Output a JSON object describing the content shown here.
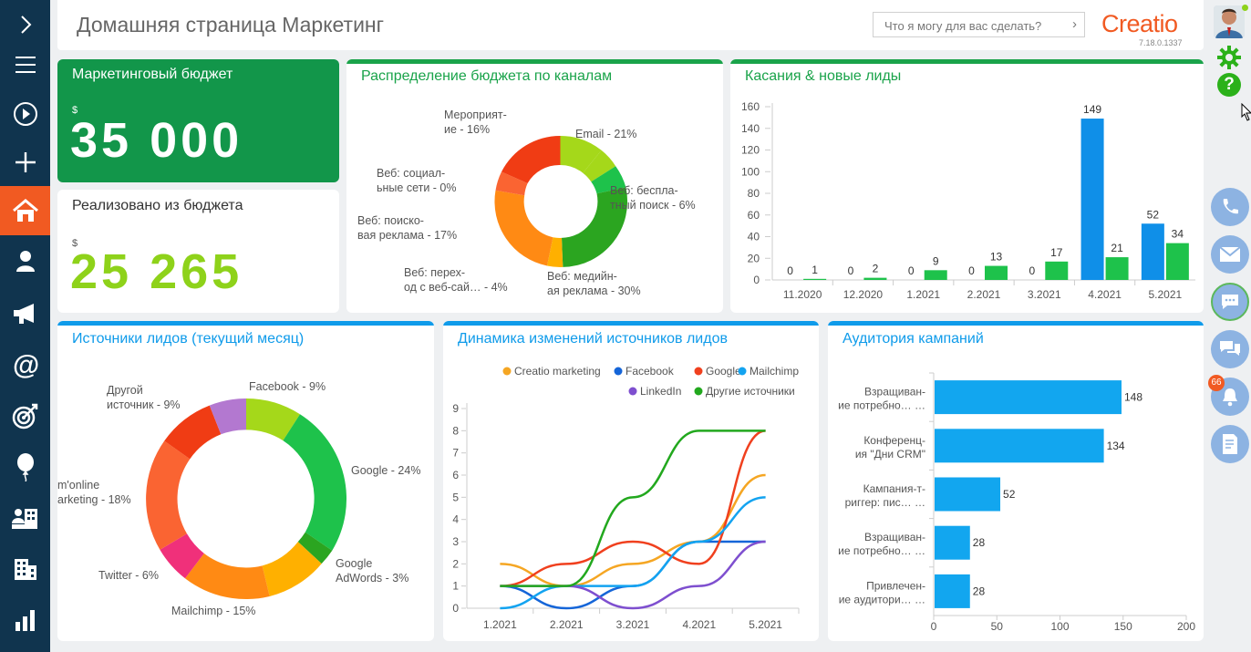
{
  "header": {
    "title": "Домашняя страница Маркетинг",
    "search_placeholder": "Что я могу для вас сделать?",
    "logo": "Creatio",
    "version": "7.18.0.1337"
  },
  "left_nav": {
    "items": [
      "expand-icon",
      "menu-icon",
      "play-icon",
      "add-icon",
      "home-icon",
      "contacts-icon",
      "campaigns-icon",
      "email-icon",
      "target-icon",
      "events-icon",
      "accounts-icon",
      "companies-icon",
      "analytics-icon"
    ]
  },
  "right_panel": {
    "notification_count": "66"
  },
  "colors": {
    "green_primary": "#1aa34a",
    "blue_accent": "#0f9bea",
    "orange": "#f15a22",
    "lime": "#8ed21a"
  },
  "budget": {
    "title": "Маркетинговый бюджет",
    "currency": "$",
    "value": "35 000"
  },
  "spent": {
    "title": "Реализовано из бюджета",
    "currency": "$",
    "value": "25 265"
  },
  "channels": {
    "title": "Распределение бюджета по каналам",
    "chart_data": {
      "type": "pie",
      "labels": [
        "Email - 21%",
        "Веб: бесплатный поиск - 6%",
        "Веб: медийная реклама - 30%",
        "Веб: переход с веб-сай… - 4%",
        "Веб: поисковая реклама - 17%",
        "Веб: социальные сети - 0%",
        "Мероприятие - 16%"
      ],
      "values": [
        21,
        6,
        30,
        4,
        17,
        0,
        16
      ]
    }
  },
  "touches": {
    "title": "Касания & новые лиды",
    "chart_data": {
      "type": "bar",
      "categories": [
        "11.2020",
        "12.2020",
        "1.2021",
        "2.2021",
        "3.2021",
        "4.2021",
        "5.2021"
      ],
      "series": [
        {
          "values": [
            0,
            0,
            0,
            0,
            0,
            149,
            52
          ]
        },
        {
          "values": [
            1,
            2,
            9,
            13,
            17,
            21,
            34
          ]
        }
      ],
      "ylim": [
        0,
        160
      ],
      "yticks": [
        "0",
        "20",
        "40",
        "60",
        "80",
        "100",
        "120",
        "140",
        "160"
      ]
    }
  },
  "sources": {
    "title": "Источники лидов (текущий месяц)",
    "chart_data": {
      "type": "pie",
      "labels": [
        "Facebook - 9%",
        "Google - 24%",
        "Google AdWords - 3%",
        "Google AdWords - 3%",
        "Mailchimp - 15%",
        "Twitter - 6%",
        "m'online marketing - 18%",
        "Другой источник - 9%"
      ],
      "values": [
        9,
        24,
        3,
        8,
        15,
        6,
        18,
        9
      ],
      "colors": [
        "#a5d81a",
        "#1ec24b",
        "#2ba520",
        "#ffb000",
        "#ff8a14",
        "#f0307a",
        "#fa6432",
        "#f03c14",
        "#b378d0"
      ]
    }
  },
  "dynamics": {
    "title": "Динамика изменений источников лидов",
    "chart_data": {
      "type": "line",
      "x": [
        "1.2021",
        "2.2021",
        "3.2021",
        "4.2021",
        "5.2021"
      ],
      "ylim": [
        0,
        9
      ],
      "yticks": [
        "0",
        "1",
        "2",
        "3",
        "4",
        "5",
        "6",
        "7",
        "8",
        "9"
      ],
      "series": [
        {
          "name": "Creatio marketing",
          "color": "#f5a623",
          "values": [
            2,
            1,
            2,
            3,
            6
          ]
        },
        {
          "name": "Facebook",
          "color": "#1565d8",
          "values": [
            1,
            0,
            1,
            3,
            3
          ]
        },
        {
          "name": "Google",
          "color": "#f0401e",
          "values": [
            1,
            2,
            3,
            2,
            8
          ]
        },
        {
          "name": "Mailchimp",
          "color": "#13a3f0",
          "values": [
            0,
            1,
            1,
            3,
            5
          ]
        },
        {
          "name": "LinkedIn",
          "color": "#7e4fcf",
          "values": [
            1,
            1,
            0,
            1,
            3
          ]
        },
        {
          "name": "Другие источники",
          "color": "#22a81e",
          "values": [
            1,
            1,
            5,
            8,
            8
          ]
        }
      ]
    }
  },
  "audience": {
    "title": "Аудитория кампаний",
    "chart_data": {
      "type": "bar",
      "categories": [
        "Взращиван- ие потребно… …",
        "Конференц- ия \"Дни CRM\"",
        "Кампания-т- риггер: пис… …",
        "Взращиван- ие потребно… …",
        "Привлечен- ие аудитори… …"
      ],
      "values": [
        148,
        134,
        52,
        28,
        28
      ],
      "xlim": [
        0,
        200
      ],
      "xticks": [
        "0",
        "50",
        "100",
        "150",
        "200"
      ]
    }
  }
}
